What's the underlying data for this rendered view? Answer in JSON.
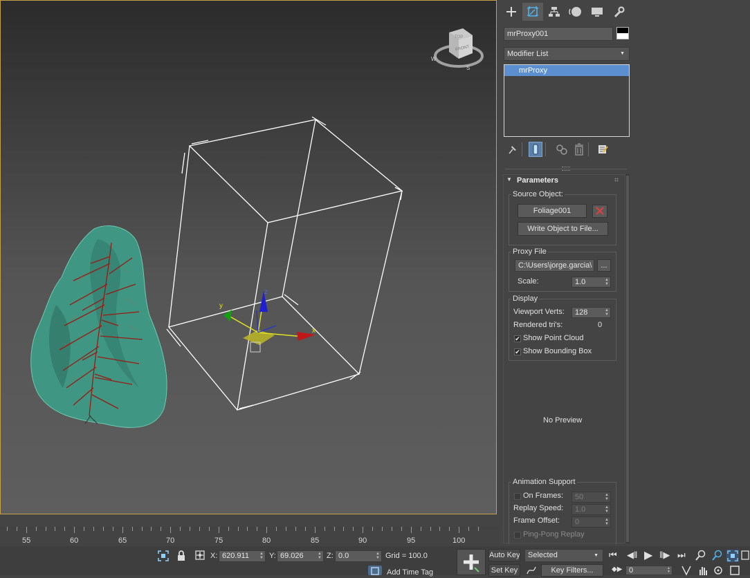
{
  "viewport": {
    "cube_labels": {
      "front": "FRONT",
      "top": "TOP"
    },
    "compass": {
      "w": "W",
      "s": "S"
    },
    "gizmo_axes": {
      "x": "x",
      "y": "y",
      "z": "z"
    }
  },
  "command_panel": {
    "tabs": [
      {
        "name": "create",
        "icon": "plus-icon"
      },
      {
        "name": "modify",
        "icon": "modify-icon"
      },
      {
        "name": "hierarchy",
        "icon": "hierarchy-icon"
      },
      {
        "name": "motion",
        "icon": "motion-icon"
      },
      {
        "name": "display",
        "icon": "display-icon"
      },
      {
        "name": "utilities",
        "icon": "wrench-icon"
      }
    ],
    "object_name": "mrProxy001",
    "object_color": "#000000",
    "modifier_list_label": "Modifier List",
    "stack_items": [
      "mrProxy"
    ],
    "stack_toolbar": [
      "pin-stack-icon",
      "show-end-result-icon",
      "make-unique-icon",
      "remove-modifier-icon",
      "configure-modifier-sets-icon"
    ]
  },
  "rollout": {
    "title": "Parameters",
    "source_object": {
      "label": "Source Object:",
      "button": "Foliage001",
      "write_button": "Write Object to File..."
    },
    "proxy_file": {
      "label": "Proxy File",
      "path": "C:\\Users\\jorge.garcia\\",
      "browse": "...",
      "scale_label": "Scale:",
      "scale_value": "1.0"
    },
    "display": {
      "label": "Display",
      "viewport_verts_label": "Viewport Verts:",
      "viewport_verts": "128",
      "rendered_tris_label": "Rendered tri's:",
      "rendered_tris": "0",
      "show_point_cloud": "Show Point Cloud",
      "show_point_cloud_checked": true,
      "show_bounding_box": "Show Bounding Box",
      "show_bounding_box_checked": true
    },
    "preview_text": "No Preview",
    "animation": {
      "label": "Animation Support",
      "on_frames_label": "On Frames:",
      "on_frames": "50",
      "replay_speed_label": "Replay Speed:",
      "replay_speed": "1.0",
      "frame_offset_label": "Frame Offset:",
      "frame_offset": "0",
      "ping_pong": "Ping-Pong Replay"
    }
  },
  "timeline": {
    "labels": [
      "55",
      "60",
      "65",
      "70",
      "75",
      "80",
      "85",
      "90",
      "95",
      "100"
    ]
  },
  "status": {
    "x_label": "X:",
    "x_value": "620.911",
    "y_label": "Y:",
    "y_value": "69.026",
    "z_label": "Z:",
    "z_value": "0.0",
    "grid": "Grid = 100.0",
    "add_time_tag": "Add Time Tag",
    "auto_key": "Auto Key",
    "set_key": "Set Key",
    "selected": "Selected",
    "key_filters": "Key Filters...",
    "frame": "0"
  }
}
